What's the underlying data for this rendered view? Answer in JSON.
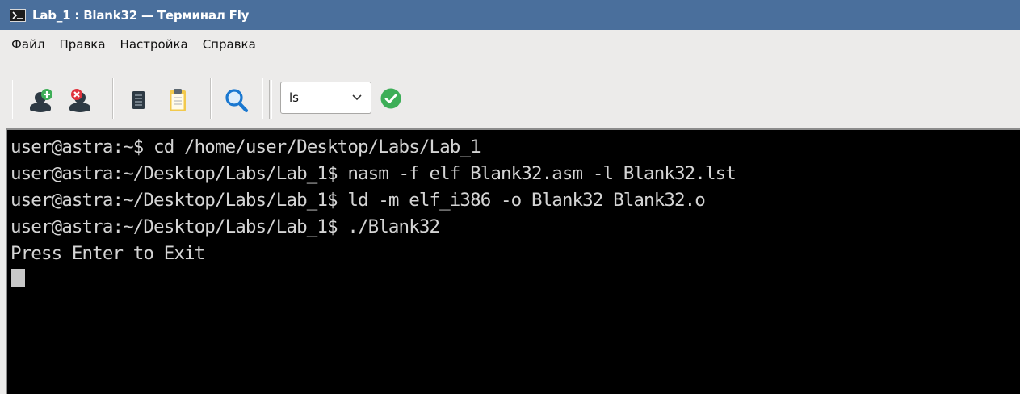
{
  "window": {
    "title": "Lab_1 : Blank32 — Терминал Fly",
    "app_icon": "terminal-icon"
  },
  "menu": {
    "items": [
      {
        "label": "Файл"
      },
      {
        "label": "Правка"
      },
      {
        "label": "Настройка"
      },
      {
        "label": "Справка"
      }
    ]
  },
  "toolbar": {
    "buttons": [
      {
        "icon": "add-user-icon"
      },
      {
        "icon": "remove-user-icon"
      },
      {
        "icon": "copy-icon"
      },
      {
        "icon": "paste-icon"
      },
      {
        "icon": "search-icon"
      }
    ],
    "command_combo": {
      "selected": "ls"
    },
    "run_icon": "checkmark-icon"
  },
  "terminal": {
    "lines": [
      "user@astra:~$ cd /home/user/Desktop/Labs/Lab_1",
      "user@astra:~/Desktop/Labs/Lab_1$ nasm -f elf Blank32.asm -l Blank32.lst",
      "user@astra:~/Desktop/Labs/Lab_1$ ld -m elf_i386 -o Blank32 Blank32.o",
      "user@astra:~/Desktop/Labs/Lab_1$ ./Blank32",
      "Press Enter to Exit"
    ]
  },
  "colors": {
    "titlebar": "#4a6f9c",
    "terminal_bg": "#000000",
    "terminal_fg": "#d4d4d4",
    "accent_green": "#3dae57"
  }
}
